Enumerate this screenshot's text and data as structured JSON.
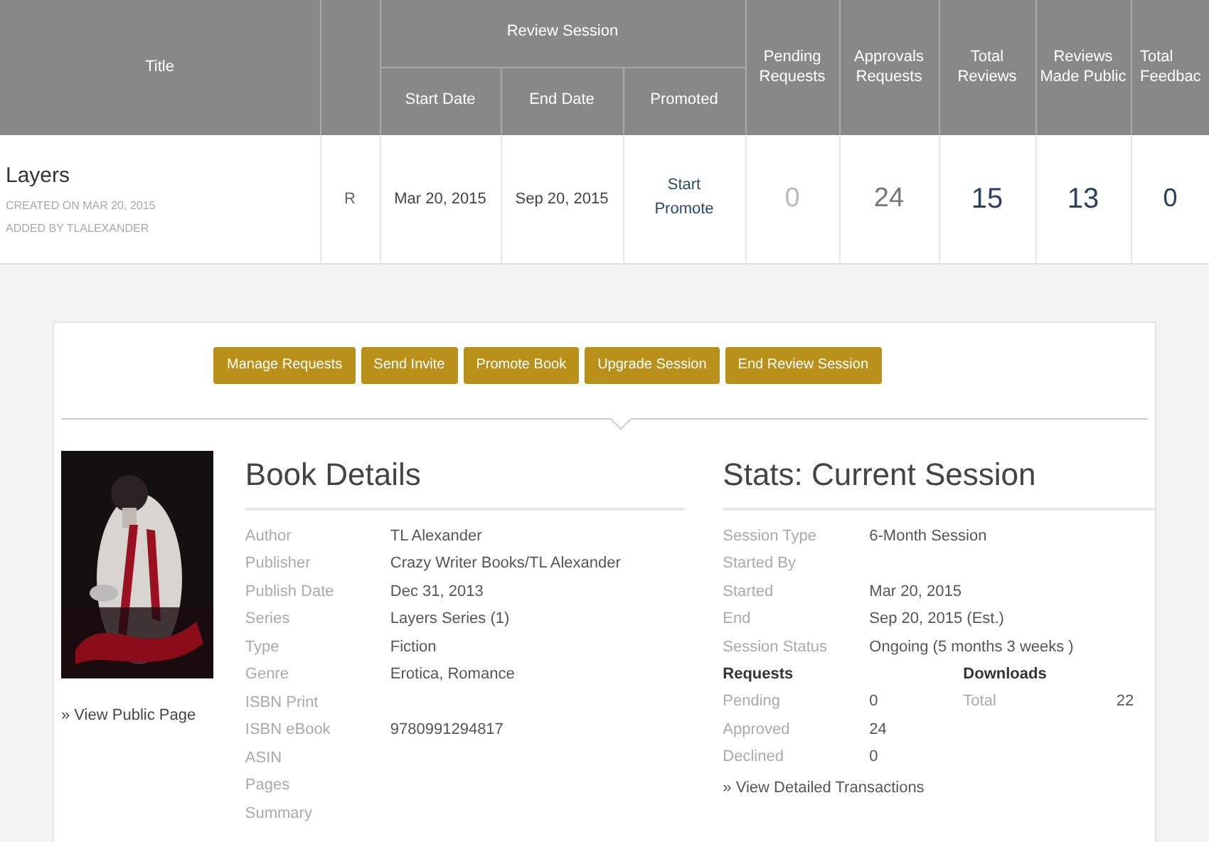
{
  "table": {
    "columns": {
      "title": "Title",
      "review_session": "Review Session",
      "start_date": "Start Date",
      "end_date": "End Date",
      "promoted": "Promoted",
      "pending": "Pending Requests",
      "approvals": "Approvals Requests",
      "total_reviews": "Total Reviews",
      "made_public": "Reviews Made Public",
      "total_feedback": "Total Feedbac"
    },
    "rows": [
      {
        "title": "Layers",
        "created": "CREATED ON MAR 20, 2015",
        "added": "ADDED BY TLALEXANDER",
        "rating": "R",
        "start_date": "Mar 20, 2015",
        "end_date": "Sep 20, 2015",
        "promote_link": "Start Promote",
        "pending": "0",
        "approvals": "24",
        "total_reviews": "15",
        "made_public": "13",
        "total_feedback": "0"
      }
    ]
  },
  "actions": [
    "Manage Requests",
    "Send Invite",
    "Promote Book",
    "Upgrade Session",
    "End Review Session"
  ],
  "view_public_page": "» View Public Page",
  "book_details": {
    "heading": "Book Details",
    "fields": [
      {
        "label": "Author",
        "value": "TL Alexander"
      },
      {
        "label": "Publisher",
        "value": "Crazy Writer Books/TL Alexander"
      },
      {
        "label": "Publish Date",
        "value": "Dec 31, 2013"
      },
      {
        "label": "Series",
        "value": "Layers Series (1)"
      },
      {
        "label": "Type",
        "value": "Fiction"
      },
      {
        "label": "Genre",
        "value": "Erotica, Romance"
      },
      {
        "label": "ISBN Print"
      },
      {
        "label": "ISBN eBook",
        "value": "9780991294817"
      },
      {
        "label": "ASIN"
      },
      {
        "label": "Pages"
      },
      {
        "label": "Summary"
      }
    ]
  },
  "stats": {
    "heading": "Stats: Current Session",
    "fields": [
      {
        "label": "Session Type",
        "value": "6-Month Session"
      },
      {
        "label": "Started By"
      },
      {
        "label": "Started",
        "value": "Mar 20, 2015"
      },
      {
        "label": "End",
        "value": "Sep 20, 2015 (Est.)"
      },
      {
        "label": "Session Status",
        "value": "Ongoing (5 months 3 weeks )"
      }
    ],
    "requests": {
      "heading": "Requests",
      "rows": [
        {
          "label": "Pending",
          "value": "0"
        },
        {
          "label": "Approved",
          "value": "24"
        },
        {
          "label": "Declined",
          "value": "0"
        }
      ]
    },
    "downloads": {
      "heading": "Downloads",
      "rows": [
        {
          "label": "Total",
          "value": "22"
        }
      ]
    },
    "link": "» View Detailed Transactions"
  }
}
